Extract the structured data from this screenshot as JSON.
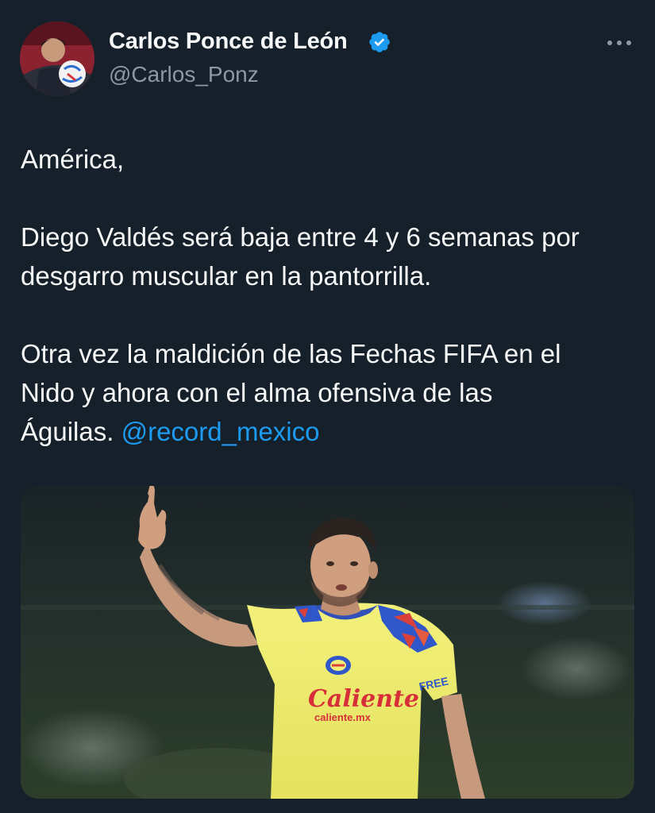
{
  "author": {
    "name": "Carlos Ponce de León",
    "handle": "@Carlos_Ponz",
    "verified": true,
    "avatar_icon": "profile-photo"
  },
  "menu": {
    "icon": "more-dots-icon"
  },
  "tweet": {
    "lines": {
      "greeting": "América,",
      "p2_l1": "Diego Valdés será baja entre 4 y 6 semanas por",
      "p2_l2": "desgarro muscular en la pantorrilla.",
      "p3_l1": "Otra vez la maldición de las Fechas FIFA en el",
      "p3_l2": "Nido y ahora con el alma ofensiva de las",
      "p3_l3": "Águilas.",
      "mention": "@record_mexico"
    }
  },
  "media": {
    "shirt_sponsor": "Caliente",
    "shirt_sponsor_sub": "caliente.mx",
    "sleeve_sponsor": "FREE"
  },
  "colors": {
    "background": "#15202b",
    "text": "#f7f9f9",
    "secondary": "#8b98a5",
    "link": "#1d9bf0",
    "verified": "#1d9bf0"
  }
}
